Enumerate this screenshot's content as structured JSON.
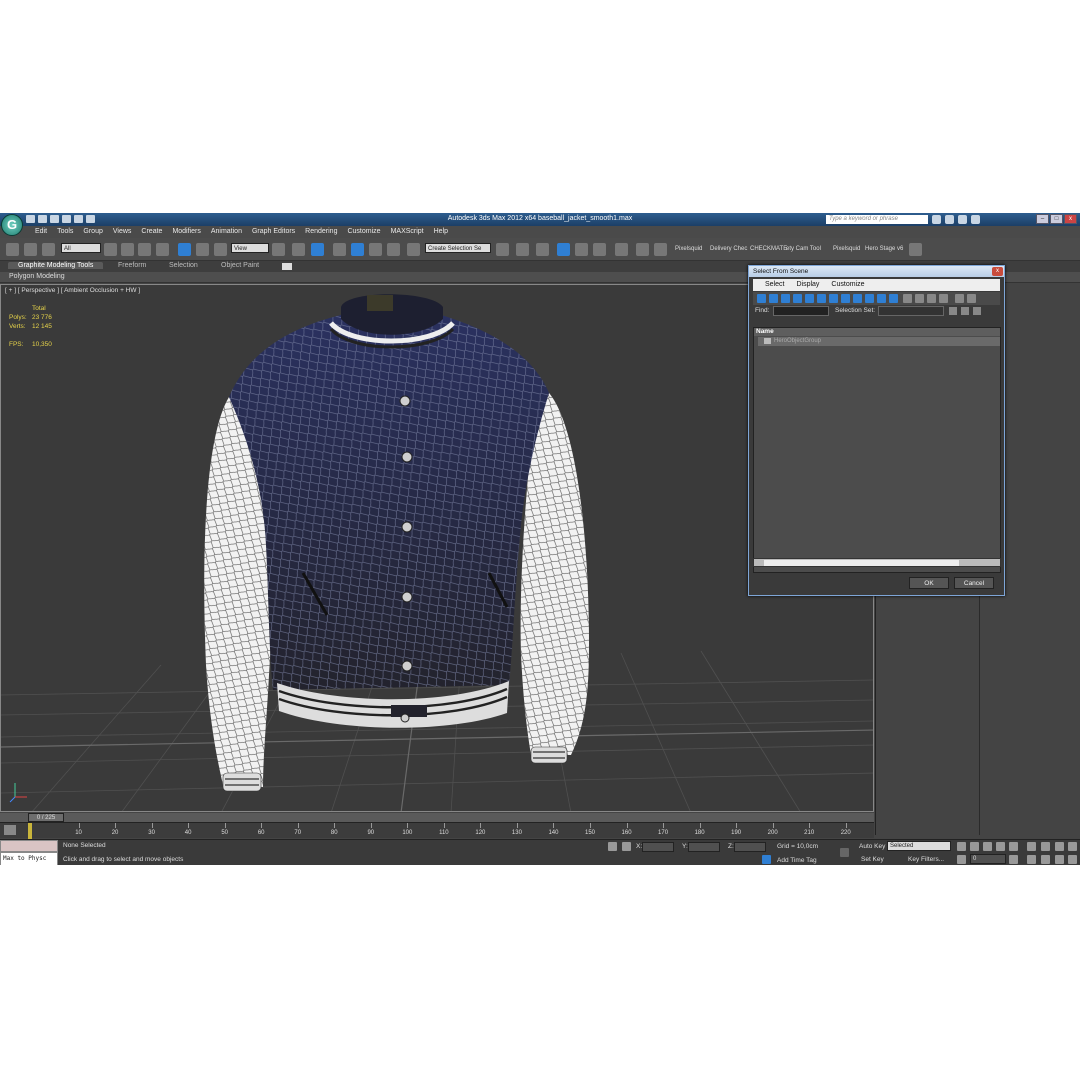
{
  "app": {
    "logo_letter": "G",
    "title": "Autodesk 3ds Max  2012 x64      baseball_jacket_smooth1.max",
    "keyword_placeholder": "Type a keyword or phrase"
  },
  "menu": [
    "Edit",
    "Tools",
    "Group",
    "Views",
    "Create",
    "Modifiers",
    "Animation",
    "Graph Editors",
    "Rendering",
    "Customize",
    "MAXScript",
    "Help"
  ],
  "toolbar": {
    "filter_select": "All",
    "refcoord_select": "View",
    "named_selection": "Create Selection Se",
    "plugins": [
      "Pixelsquid",
      "Delivery Chec",
      "CHECKMATE",
      "ety Cam Tool",
      "Pixelsquid",
      "Hero Stage v6"
    ]
  },
  "ribbon": {
    "tabs": [
      "Graphite Modeling Tools",
      "Freeform",
      "Selection",
      "Object Paint"
    ],
    "sub": "Polygon Modeling"
  },
  "viewport": {
    "label": "[ + ] [ Perspective ] [ Ambient Occlusion + HW ]",
    "stats_header": "Total",
    "stats": [
      {
        "k": "Polys:",
        "v": "23 776"
      },
      {
        "k": "Verts:",
        "v": "12 145"
      }
    ],
    "fps_label": "FPS:",
    "fps_value": "10,350"
  },
  "dialog": {
    "title": "Select From Scene",
    "close": "x",
    "menu": [
      "Select",
      "Display",
      "Customize"
    ],
    "find_label": "Find:",
    "selset_label": "Selection Set:",
    "list_header": "Name",
    "items": [
      "HeroObjectGroup"
    ],
    "ok": "OK",
    "cancel": "Cancel"
  },
  "timeline": {
    "slider": "0 / 225",
    "ticks": [
      "10",
      "20",
      "30",
      "40",
      "50",
      "60",
      "70",
      "80",
      "90",
      "100",
      "110",
      "120",
      "130",
      "140",
      "150",
      "160",
      "170",
      "180",
      "190",
      "200",
      "210",
      "220"
    ]
  },
  "status": {
    "maxscript": "Max to Physc",
    "selection": "None Selected",
    "prompt": "Click and drag to select and move objects",
    "x_label": "X:",
    "y_label": "Y:",
    "z_label": "Z:",
    "grid": "Grid = 10,0cm",
    "add_time_tag": "Add Time Tag",
    "auto_key": "Auto Key",
    "set_key": "Set Key",
    "key_mode": "Selected",
    "key_filters": "Key Filters...",
    "frame": "0"
  },
  "colors": {
    "jacket_body": "#1f2547",
    "sleeves": "#f2f2f2",
    "accent_blue": "#2f7fd3",
    "stats_yellow": "#e6d34a"
  }
}
